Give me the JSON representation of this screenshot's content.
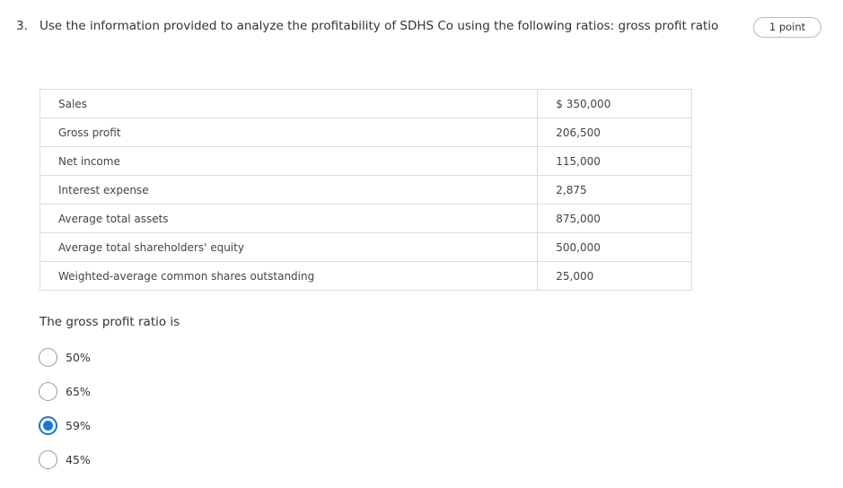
{
  "question": {
    "number": "3.",
    "text": "Use the information provided to analyze the profitability of SDHS Co using the following ratios: gross profit ratio",
    "points": "1 point"
  },
  "table": {
    "rows": [
      {
        "label": "Sales",
        "value": "$ 350,000"
      },
      {
        "label": "Gross profit",
        "value": "206,500"
      },
      {
        "label": "Net income",
        "value": "115,000"
      },
      {
        "label": "Interest expense",
        "value": "2,875"
      },
      {
        "label": "Average total assets",
        "value": "875,000"
      },
      {
        "label": "Average total shareholders' equity",
        "value": "500,000"
      },
      {
        "label": "Weighted-average common shares outstanding",
        "value": "25,000"
      }
    ]
  },
  "prompt": "The gross profit ratio is",
  "options": [
    {
      "label": "50%",
      "selected": false
    },
    {
      "label": "65%",
      "selected": false
    },
    {
      "label": "59%",
      "selected": true
    },
    {
      "label": "45%",
      "selected": false
    }
  ],
  "colors": {
    "accent": "#1a73d9",
    "border": "#dcdcdc",
    "text": "#333333"
  }
}
